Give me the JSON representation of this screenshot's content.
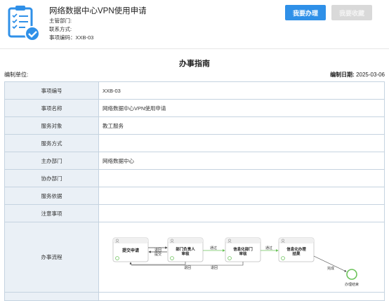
{
  "item": {
    "title": "网络数据中心VPN使用申请",
    "meta": [
      "主管部门:",
      "联系方式:",
      "事项编码：XXB-03"
    ]
  },
  "buttons": {
    "apply": "我要办理",
    "favorite": "我要收藏"
  },
  "guide": {
    "title": "办事指南",
    "unit_label": "编制单位:",
    "date_label": "编制日期:",
    "date_value": "2025-03-06"
  },
  "table": {
    "rows": [
      {
        "label": "事项编号",
        "value": "XXB-03"
      },
      {
        "label": "事项名称",
        "value": "网络数据中心VPN使用申请"
      },
      {
        "label": "服务对象",
        "value": "教工服务"
      },
      {
        "label": "服务方式",
        "value": ""
      },
      {
        "label": "主办部门",
        "value": "网络数据中心"
      },
      {
        "label": "协办部门",
        "value": ""
      },
      {
        "label": "服务依据",
        "value": ""
      },
      {
        "label": "注意事项",
        "value": ""
      }
    ],
    "flow_label": "办事流程"
  },
  "flow": {
    "nodes": [
      "提交申请",
      "部门负责人审核",
      "信息化部门审核",
      "信息化办理结果"
    ],
    "edges": [
      "退回\n提交",
      "通过",
      "通过",
      "退回",
      "退回",
      "完成"
    ],
    "end_label": "办理结束"
  },
  "colors": {
    "primary": "#2f90e8",
    "label_bg": "#eaf0f6",
    "border": "#c5d3e0",
    "flow_green": "#6cc35a"
  },
  "icons": [
    "document-checklist-icon",
    "check-circle-icon",
    "user-icon"
  ]
}
